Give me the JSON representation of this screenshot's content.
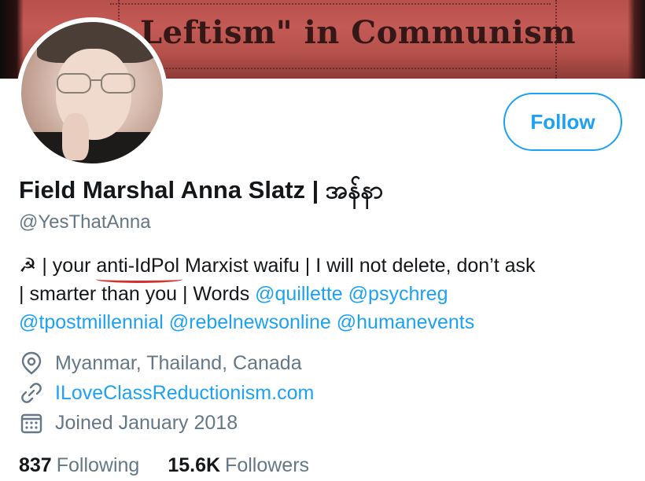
{
  "banner": {
    "text": "Leftism\" in Communism"
  },
  "profile": {
    "display_name": "Field Marshal Anna Slatz | အန်နာ",
    "handle": "@YesThatAnna"
  },
  "follow_button": {
    "label": "Follow"
  },
  "bio": {
    "line1_prefix": "☭ | your ",
    "line1_underlined": "anti-IdPol",
    "line1_suffix": " Marxist waifu | I will not delete, don’t ask",
    "line2_text": "| smarter than you | Words ",
    "line2_mention1": "@quillette",
    "line2_mention2": "@psychreg",
    "line3_mention1": "@tpostmillennial",
    "line3_mention2": "@rebelnewsonline",
    "line3_mention3": "@humanevents"
  },
  "meta": {
    "location": "Myanmar, Thailand, Canada",
    "website": "ILoveClassReductionism.com",
    "joined": "Joined January 2018"
  },
  "stats": {
    "following_count": "837",
    "following_label": "Following",
    "followers_count": "15.6K",
    "followers_label": "Followers"
  },
  "colors": {
    "accent": "#1da1f2",
    "secondary_text": "#657786",
    "primary_text": "#14171a",
    "banner_red": "#c45a55",
    "underline_red": "#d9302b"
  }
}
